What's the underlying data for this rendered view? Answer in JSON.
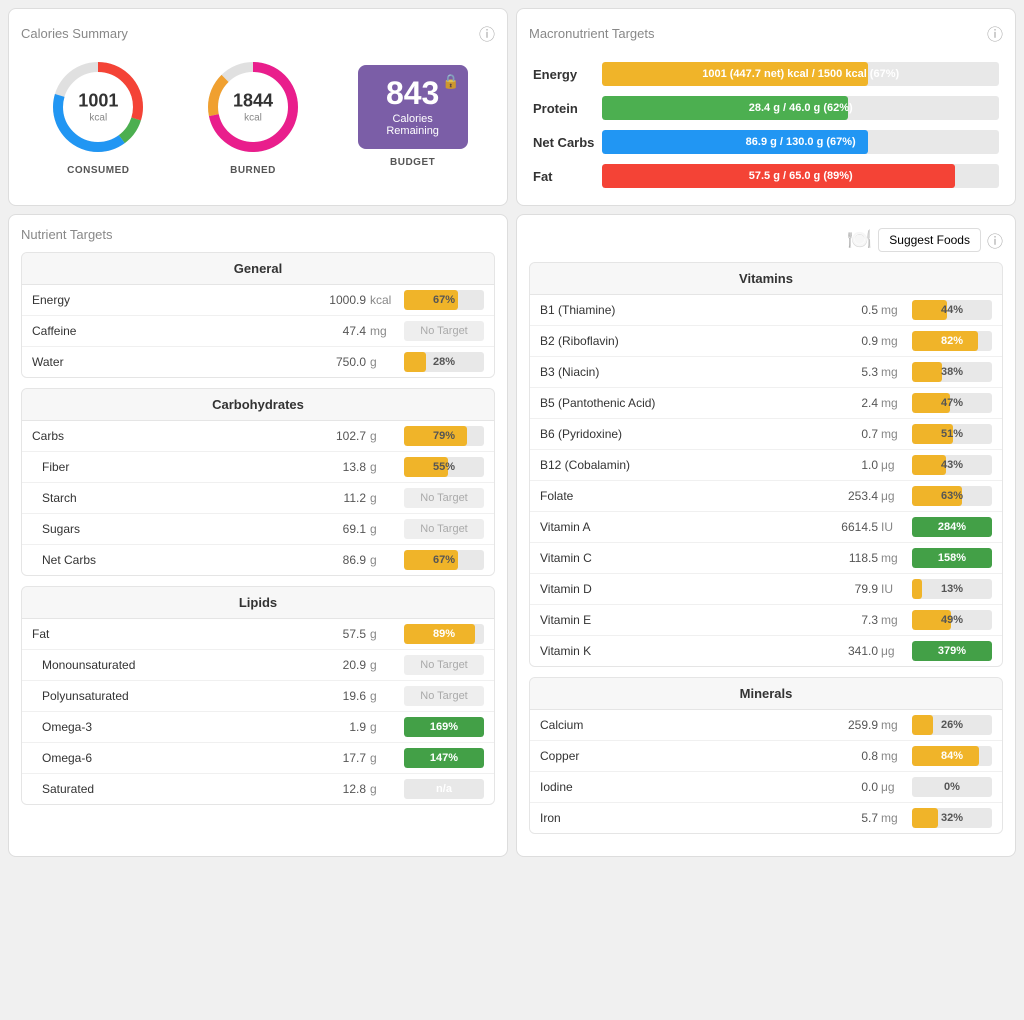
{
  "calorieSummary": {
    "title": "Calories Summary",
    "consumed": {
      "value": "1001",
      "unit": "kcal",
      "label": "CONSUMED"
    },
    "burned": {
      "value": "1844",
      "unit": "kcal",
      "label": "BURNED"
    },
    "budget": {
      "value": "843",
      "text": "Calories Remaining",
      "label": "BUDGET"
    }
  },
  "macroTargets": {
    "title": "Macronutrient Targets",
    "rows": [
      {
        "name": "Energy",
        "bar_text": "1001 (447.7 net) kcal / 1500 kcal (67%)",
        "pct": 67,
        "color": "#f0b429"
      },
      {
        "name": "Protein",
        "bar_text": "28.4 g / 46.0 g (62%)",
        "pct": 62,
        "color": "#4caf50"
      },
      {
        "name": "Net Carbs",
        "bar_text": "86.9 g / 130.0 g (67%)",
        "pct": 67,
        "color": "#2196f3"
      },
      {
        "name": "Fat",
        "bar_text": "57.5 g / 65.0 g (89%)",
        "pct": 89,
        "color": "#f44336"
      }
    ]
  },
  "nutrientTargets": {
    "title": "Nutrient Targets",
    "suggestButton": "Suggest Foods",
    "general": {
      "title": "General",
      "rows": [
        {
          "name": "Energy",
          "value": "1000.9",
          "unit": "kcal",
          "pct": 67,
          "noTarget": false,
          "label": "67%"
        },
        {
          "name": "Caffeine",
          "value": "47.4",
          "unit": "mg",
          "pct": 0,
          "noTarget": true,
          "label": "No Target"
        },
        {
          "name": "Water",
          "value": "750.0",
          "unit": "g",
          "pct": 28,
          "noTarget": false,
          "label": "28%"
        }
      ]
    },
    "carbohydrates": {
      "title": "Carbohydrates",
      "rows": [
        {
          "name": "Carbs",
          "value": "102.7",
          "unit": "g",
          "pct": 79,
          "noTarget": false,
          "label": "79%",
          "indent": false
        },
        {
          "name": "Fiber",
          "value": "13.8",
          "unit": "g",
          "pct": 55,
          "noTarget": false,
          "label": "55%",
          "indent": true
        },
        {
          "name": "Starch",
          "value": "11.2",
          "unit": "g",
          "pct": 0,
          "noTarget": true,
          "label": "No Target",
          "indent": true
        },
        {
          "name": "Sugars",
          "value": "69.1",
          "unit": "g",
          "pct": 0,
          "noTarget": true,
          "label": "No Target",
          "indent": true
        },
        {
          "name": "Net Carbs",
          "value": "86.9",
          "unit": "g",
          "pct": 67,
          "noTarget": false,
          "label": "67%",
          "indent": true
        }
      ]
    },
    "lipids": {
      "title": "Lipids",
      "rows": [
        {
          "name": "Fat",
          "value": "57.5",
          "unit": "g",
          "pct": 89,
          "noTarget": false,
          "label": "89%",
          "indent": false
        },
        {
          "name": "Monounsaturated",
          "value": "20.9",
          "unit": "g",
          "pct": 0,
          "noTarget": true,
          "label": "No Target",
          "indent": true
        },
        {
          "name": "Polyunsaturated",
          "value": "19.6",
          "unit": "g",
          "pct": 0,
          "noTarget": true,
          "label": "No Target",
          "indent": true
        },
        {
          "name": "Omega-3",
          "value": "1.9",
          "unit": "g",
          "pct": 100,
          "noTarget": false,
          "label": "169%",
          "green": true,
          "indent": true
        },
        {
          "name": "Omega-6",
          "value": "17.7",
          "unit": "g",
          "pct": 100,
          "noTarget": false,
          "label": "147%",
          "green": true,
          "indent": true
        },
        {
          "name": "Saturated",
          "value": "12.8",
          "unit": "g",
          "pct": 0,
          "noTarget": false,
          "label": "n/a",
          "na": true,
          "indent": true
        }
      ]
    }
  },
  "vitamins": {
    "title": "Vitamins",
    "rows": [
      {
        "name": "B1 (Thiamine)",
        "value": "0.5",
        "unit": "mg",
        "pct": 44,
        "label": "44%",
        "green": false
      },
      {
        "name": "B2 (Riboflavin)",
        "value": "0.9",
        "unit": "mg",
        "pct": 82,
        "label": "82%",
        "green": false
      },
      {
        "name": "B3 (Niacin)",
        "value": "5.3",
        "unit": "mg",
        "pct": 38,
        "label": "38%",
        "green": false
      },
      {
        "name": "B5 (Pantothenic Acid)",
        "value": "2.4",
        "unit": "mg",
        "pct": 47,
        "label": "47%",
        "green": false
      },
      {
        "name": "B6 (Pyridoxine)",
        "value": "0.7",
        "unit": "mg",
        "pct": 51,
        "label": "51%",
        "green": false
      },
      {
        "name": "B12 (Cobalamin)",
        "value": "1.0",
        "unit": "μg",
        "pct": 43,
        "label": "43%",
        "green": false
      },
      {
        "name": "Folate",
        "value": "253.4",
        "unit": "μg",
        "pct": 63,
        "label": "63%",
        "green": false
      },
      {
        "name": "Vitamin A",
        "value": "6614.5",
        "unit": "IU",
        "pct": 100,
        "label": "284%",
        "green": true
      },
      {
        "name": "Vitamin C",
        "value": "118.5",
        "unit": "mg",
        "pct": 100,
        "label": "158%",
        "green": true
      },
      {
        "name": "Vitamin D",
        "value": "79.9",
        "unit": "IU",
        "pct": 13,
        "label": "13%",
        "green": false
      },
      {
        "name": "Vitamin E",
        "value": "7.3",
        "unit": "mg",
        "pct": 49,
        "label": "49%",
        "green": false
      },
      {
        "name": "Vitamin K",
        "value": "341.0",
        "unit": "μg",
        "pct": 100,
        "label": "379%",
        "green": true
      }
    ]
  },
  "minerals": {
    "title": "Minerals",
    "rows": [
      {
        "name": "Calcium",
        "value": "259.9",
        "unit": "mg",
        "pct": 26,
        "label": "26%",
        "green": false
      },
      {
        "name": "Copper",
        "value": "0.8",
        "unit": "mg",
        "pct": 84,
        "label": "84%",
        "green": false
      },
      {
        "name": "Iodine",
        "value": "0.0",
        "unit": "μg",
        "pct": 0,
        "label": "0%",
        "green": false
      },
      {
        "name": "Iron",
        "value": "5.7",
        "unit": "mg",
        "pct": 32,
        "label": "32%",
        "green": false
      }
    ]
  },
  "colors": {
    "orange": "#f0b429",
    "green": "#4caf50",
    "blue": "#2196f3",
    "red": "#f44336",
    "purple": "#7b5ea7",
    "darkGreen": "#43a047"
  }
}
